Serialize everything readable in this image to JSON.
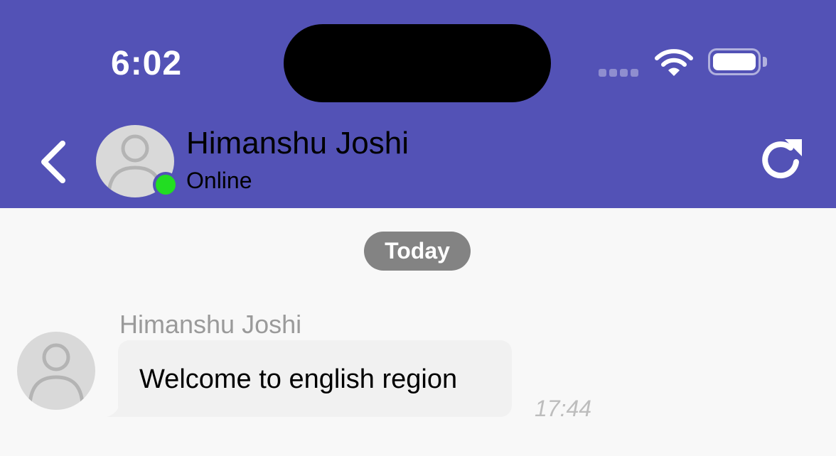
{
  "status_bar": {
    "time": "6:02"
  },
  "header": {
    "contact_name": "Himanshu Joshi",
    "contact_status": "Online",
    "back_icon": "chevron-left-icon",
    "refresh_icon": "refresh-icon"
  },
  "chat": {
    "date_separator": "Today",
    "messages": [
      {
        "sender": "Himanshu Joshi",
        "text": "Welcome to english region",
        "time": "17:44"
      }
    ]
  },
  "colors": {
    "header_bg": "#5352b6",
    "online": "#22dd22",
    "chat_bg": "#f8f8f8",
    "bubble_bg": "#f1f1f1"
  }
}
